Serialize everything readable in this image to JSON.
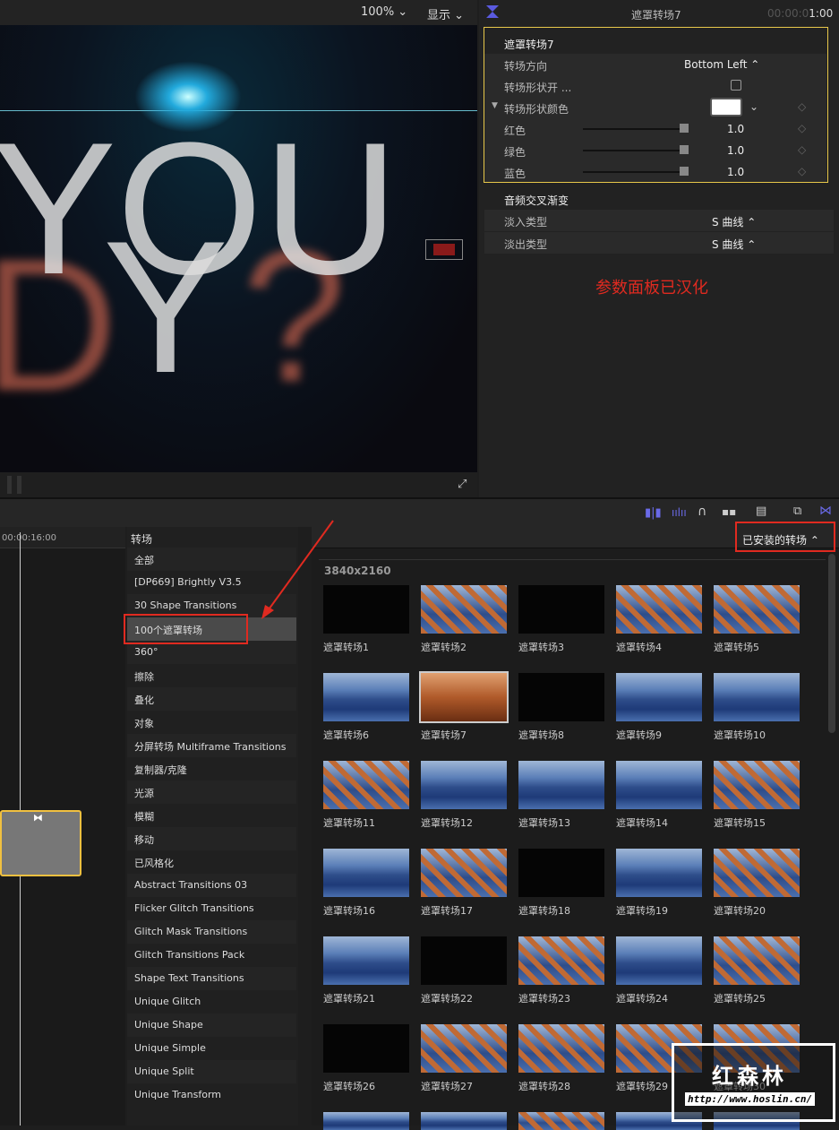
{
  "viewer": {
    "zoom": "100%",
    "display": "显示",
    "canvas_text_1": "YOU",
    "canvas_text_2": "Y",
    "canvas_text_3": "D",
    "canvas_text_4": "?"
  },
  "inspector": {
    "title": "遮罩转场7",
    "timecode_dim": "00:00:0",
    "timecode": "1:00",
    "section": "遮罩转场7",
    "rows": [
      {
        "label": "转场方向",
        "value": "Bottom Left ⌃"
      },
      {
        "label": "转场形状开 ...",
        "value": ""
      },
      {
        "label": "转场形状颜色",
        "value": ""
      },
      {
        "label": "红色",
        "value": "1.0"
      },
      {
        "label": "绿色",
        "value": "1.0"
      },
      {
        "label": "蓝色",
        "value": "1.0"
      }
    ],
    "audio_section": "音频交叉渐变",
    "fade_in_label": "淡入类型",
    "fade_in_value": "S 曲线 ⌃",
    "fade_out_label": "淡出类型",
    "fade_out_value": "S 曲线 ⌃",
    "color_value": "#ffffff"
  },
  "annotation": {
    "note": "参数面板已汉化",
    "color": "#e02a20"
  },
  "timeline": {
    "timecode": "00:00:16:00"
  },
  "browser": {
    "header": "转场",
    "filter": "已安装的转场 ⌃",
    "group": "3840x2160",
    "categories": [
      "全部",
      "[DP669] Brightly V3.5",
      "30 Shape Transitions",
      "100个遮罩转场",
      "360°",
      "擦除",
      "叠化",
      "对象",
      "分屏转场 Multiframe Transitions",
      "复制器/克隆",
      "光源",
      "模糊",
      "移动",
      "已风格化",
      "Abstract Transitions 03",
      "Flicker Glitch Transitions",
      "Glitch Mask Transitions",
      "Glitch Transitions Pack",
      "Shape Text Transitions",
      "Unique Glitch",
      "Unique Shape",
      "Unique Simple",
      "Unique Split",
      "Unique Transform"
    ],
    "selected_category": "100个遮罩转场",
    "items": [
      {
        "name": "遮罩转场1",
        "thumb": "black"
      },
      {
        "name": "遮罩转场2",
        "thumb": "mix"
      },
      {
        "name": "遮罩转场3",
        "thumb": "black"
      },
      {
        "name": "遮罩转场4",
        "thumb": "mix"
      },
      {
        "name": "遮罩转场5",
        "thumb": "mix"
      },
      {
        "name": "遮罩转场6",
        "thumb": "blue"
      },
      {
        "name": "遮罩转场7",
        "thumb": "orange"
      },
      {
        "name": "遮罩转场8",
        "thumb": "black"
      },
      {
        "name": "遮罩转场9",
        "thumb": "blue"
      },
      {
        "name": "遮罩转场10",
        "thumb": "blue"
      },
      {
        "name": "遮罩转场11",
        "thumb": "mix"
      },
      {
        "name": "遮罩转场12",
        "thumb": "blue"
      },
      {
        "name": "遮罩转场13",
        "thumb": "blue"
      },
      {
        "name": "遮罩转场14",
        "thumb": "blue"
      },
      {
        "name": "遮罩转场15",
        "thumb": "mix"
      },
      {
        "name": "遮罩转场16",
        "thumb": "blue"
      },
      {
        "name": "遮罩转场17",
        "thumb": "mix"
      },
      {
        "name": "遮罩转场18",
        "thumb": "black"
      },
      {
        "name": "遮罩转场19",
        "thumb": "blue"
      },
      {
        "name": "遮罩转场20",
        "thumb": "mix"
      },
      {
        "name": "遮罩转场21",
        "thumb": "blue"
      },
      {
        "name": "遮罩转场22",
        "thumb": "black"
      },
      {
        "name": "遮罩转场23",
        "thumb": "mix"
      },
      {
        "name": "遮罩转场24",
        "thumb": "blue"
      },
      {
        "name": "遮罩转场25",
        "thumb": "mix"
      },
      {
        "name": "遮罩转场26",
        "thumb": "black"
      },
      {
        "name": "遮罩转场27",
        "thumb": "mix"
      },
      {
        "name": "遮罩转场28",
        "thumb": "mix"
      },
      {
        "name": "遮罩转场29",
        "thumb": "mix"
      },
      {
        "name": "遮罩转场30",
        "thumb": "mix"
      }
    ],
    "selected_item": "遮罩转场7"
  },
  "watermark": {
    "title": "红森林",
    "url": "http://www.hoslin.cn/"
  }
}
